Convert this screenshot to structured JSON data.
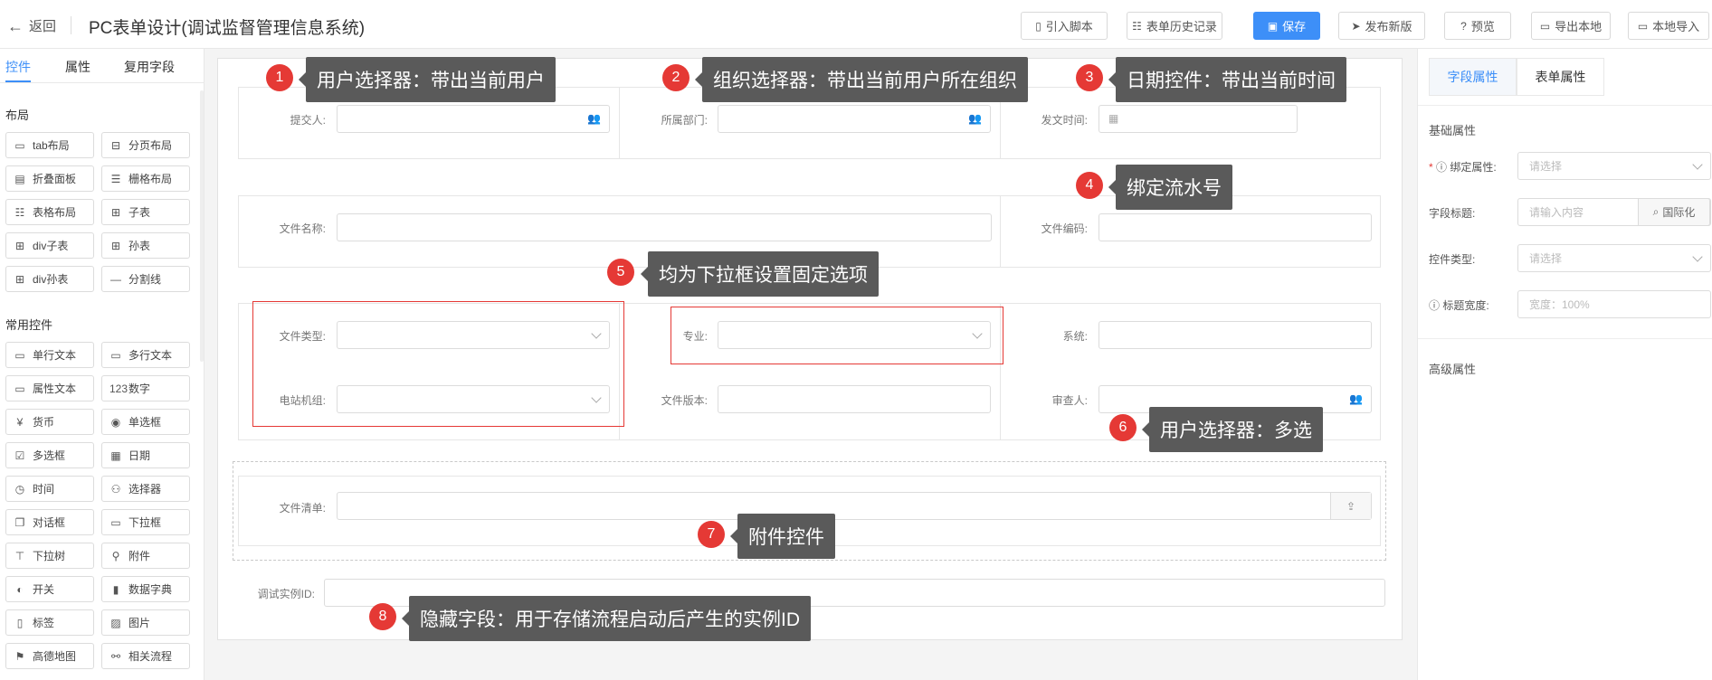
{
  "header": {
    "back_label": "返回",
    "title": "PC表单设计(调试监督管理信息系统)",
    "buttons": [
      {
        "label": "引入脚本",
        "icon": "script-icon"
      },
      {
        "label": "表单历史记录",
        "icon": "history-icon"
      },
      {
        "label": "保存",
        "icon": "save-icon"
      },
      {
        "label": "发布新版",
        "icon": "send-icon"
      },
      {
        "label": "预览",
        "icon": "preview-icon"
      },
      {
        "label": "导出本地",
        "icon": "folder-icon"
      },
      {
        "label": "本地导入",
        "icon": "folder-open-icon"
      }
    ],
    "accent": "#3d8ff8"
  },
  "left_panel": {
    "tabs": [
      "控件",
      "属性",
      "复用字段"
    ],
    "sections": [
      {
        "title": "布局",
        "items": [
          {
            "label": "tab布局",
            "icon": "▭"
          },
          {
            "label": "分页布局",
            "icon": "⊟"
          },
          {
            "label": "折叠面板",
            "icon": "▤"
          },
          {
            "label": "栅格布局",
            "icon": "☰"
          },
          {
            "label": "表格布局",
            "icon": "☷"
          },
          {
            "label": "子表",
            "icon": "⊞"
          },
          {
            "label": "div子表",
            "icon": "⊞"
          },
          {
            "label": "孙表",
            "icon": "⊞"
          },
          {
            "label": "div孙表",
            "icon": "⊞"
          },
          {
            "label": "分割线",
            "icon": "—"
          }
        ]
      },
      {
        "title": "常用控件",
        "items": [
          {
            "label": "单行文本",
            "icon": "▭"
          },
          {
            "label": "多行文本",
            "icon": "▭"
          },
          {
            "label": "属性文本",
            "icon": "▭"
          },
          {
            "label": "数字",
            "icon": "123"
          },
          {
            "label": "货币",
            "icon": "¥"
          },
          {
            "label": "单选框",
            "icon": "◉"
          },
          {
            "label": "多选框",
            "icon": "☑"
          },
          {
            "label": "日期",
            "icon": "▦"
          },
          {
            "label": "时间",
            "icon": "◷"
          },
          {
            "label": "选择器",
            "icon": "⚇"
          },
          {
            "label": "对话框",
            "icon": "❐"
          },
          {
            "label": "下拉框",
            "icon": "▭"
          },
          {
            "label": "下拉树",
            "icon": "⊤"
          },
          {
            "label": "附件",
            "icon": "⚲"
          },
          {
            "label": "开关",
            "icon": "◐"
          },
          {
            "label": "数据字典",
            "icon": "▮"
          },
          {
            "label": "标签",
            "icon": "▯"
          },
          {
            "label": "图片",
            "icon": "▨"
          },
          {
            "label": "高德地图",
            "icon": "⚑"
          },
          {
            "label": "相关流程",
            "icon": "⚯"
          }
        ]
      }
    ]
  },
  "form": {
    "row1": {
      "submitter_label": "提交人:",
      "department_label": "所属部门:",
      "sent_time_label": "发文时间:"
    },
    "row2": {
      "file_name_label": "文件名称:",
      "file_code_label": "文件编码:"
    },
    "row3": {
      "file_type_label": "文件类型:",
      "major_label": "专业:",
      "system_label": "系统:",
      "unit_label": "电站机组:",
      "version_label": "文件版本:",
      "reviewer_label": "审查人:"
    },
    "attachment_label": "文件清单:",
    "instance_id_label": "调试实例ID:"
  },
  "annotations": [
    {
      "num": "1",
      "text": "用户选择器：带出当前用户"
    },
    {
      "num": "2",
      "text": "组织选择器：带出当前用户所在组织"
    },
    {
      "num": "3",
      "text": "日期控件：带出当前时间"
    },
    {
      "num": "4",
      "text": "绑定流水号"
    },
    {
      "num": "5",
      "text": "均为下拉框设置固定选项"
    },
    {
      "num": "6",
      "text": "用户选择器：多选"
    },
    {
      "num": "7",
      "text": "附件控件"
    },
    {
      "num": "8",
      "text": "隐藏字段：用于存储流程启动后产生的实例ID"
    }
  ],
  "right_panel": {
    "tabs": [
      "字段属性",
      "表单属性"
    ],
    "basic_title": "基础属性",
    "bind_label": "绑定属性:",
    "bind_placeholder": "请选择",
    "field_title_label": "字段标题:",
    "field_title_placeholder": "请输入内容",
    "i18n_label": "国际化",
    "control_type_label": "控件类型:",
    "control_type_placeholder": "请选择",
    "title_width_label": "标题宽度:",
    "title_width_placeholder": "宽度：100%",
    "advanced_title": "高级属性"
  }
}
